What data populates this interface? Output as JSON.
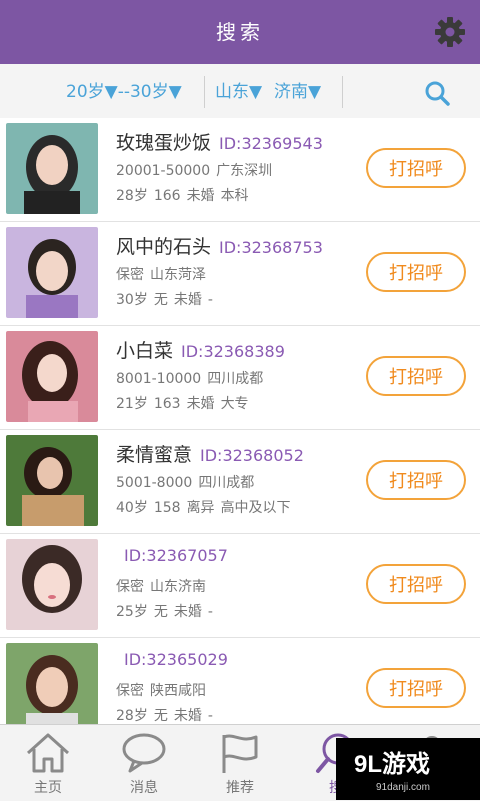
{
  "header": {
    "title": "搜索",
    "settings_icon": "gear-icon"
  },
  "filters": {
    "age": "20岁▼--30岁▼",
    "province": "山东▼",
    "city": "济南▼",
    "search_icon": "search-icon"
  },
  "colors": {
    "header": "#7d56a3",
    "filter_text": "#4aa3d8",
    "id_text": "#8a5ab3",
    "greet_border": "#f3a33a",
    "greet_text": "#f08a1d"
  },
  "users": [
    {
      "nick": "玫瑰蛋炒饭",
      "id": "ID:32369543",
      "income": "20001-50000",
      "location": "广东深圳",
      "age": "28岁",
      "height": "166",
      "marital": "未婚",
      "education": "本科",
      "greet": "打招呼"
    },
    {
      "nick": "风中的石头",
      "id": "ID:32368753",
      "income": "保密",
      "location": "山东菏泽",
      "age": "30岁",
      "height": "无",
      "marital": "未婚",
      "education": "-",
      "greet": "打招呼"
    },
    {
      "nick": "小白菜",
      "id": "ID:32368389",
      "income": "8001-10000",
      "location": "四川成都",
      "age": "21岁",
      "height": "163",
      "marital": "未婚",
      "education": "大专",
      "greet": "打招呼"
    },
    {
      "nick": "柔情蜜意",
      "id": "ID:32368052",
      "income": "5001-8000",
      "location": "四川成都",
      "age": "40岁",
      "height": "158",
      "marital": "离异",
      "education": "高中及以下",
      "greet": "打招呼"
    },
    {
      "nick": "",
      "id": "ID:32367057",
      "income": "保密",
      "location": "山东济南",
      "age": "25岁",
      "height": "无",
      "marital": "未婚",
      "education": "-",
      "greet": "打招呼"
    },
    {
      "nick": "",
      "id": "ID:32365029",
      "income": "保密",
      "location": "陕西咸阳",
      "age": "28岁",
      "height": "无",
      "marital": "未婚",
      "education": "-",
      "greet": "打招呼"
    }
  ],
  "tabs": [
    {
      "label": "主页",
      "icon": "home-icon"
    },
    {
      "label": "消息",
      "icon": "message-icon"
    },
    {
      "label": "推荐",
      "icon": "flag-icon"
    },
    {
      "label": "搜",
      "icon": "search-icon"
    },
    {
      "label": "",
      "icon": "profile-icon"
    }
  ],
  "watermark": {
    "brand": "9L游戏",
    "url": "91danji.com"
  }
}
